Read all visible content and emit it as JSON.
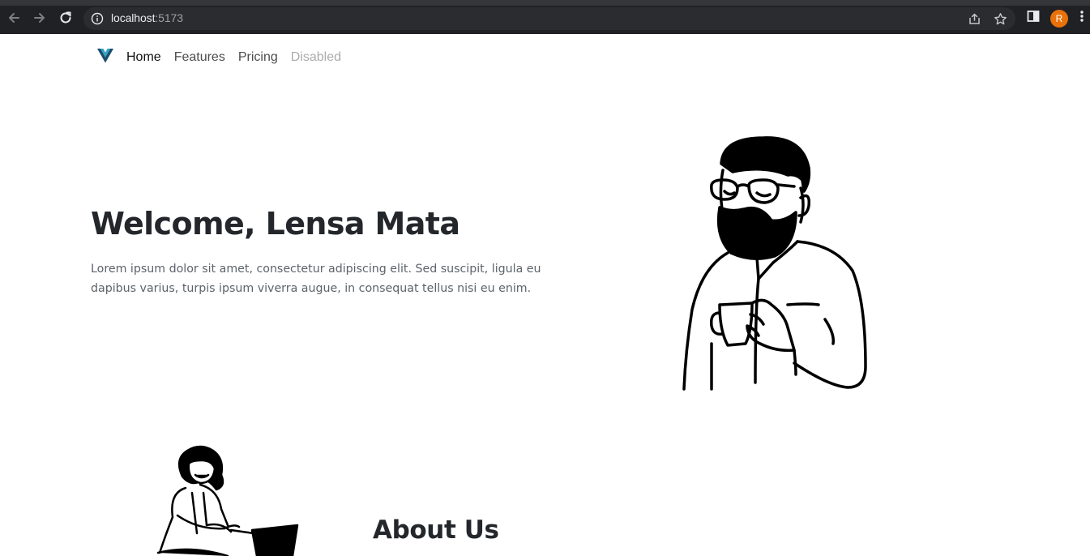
{
  "browser": {
    "url_host": "localhost",
    "url_port": ":5173",
    "profile_initial": "R",
    "icons": [
      "back-arrow-icon",
      "forward-arrow-icon",
      "reload-icon",
      "info-icon",
      "share-icon",
      "star-icon",
      "side-panel-icon",
      "kebab-menu-icon"
    ]
  },
  "navbar": {
    "logo": "vue-logo",
    "links": [
      {
        "label": "Home",
        "state": "active"
      },
      {
        "label": "Features",
        "state": "normal"
      },
      {
        "label": "Pricing",
        "state": "normal"
      },
      {
        "label": "Disabled",
        "state": "disabled"
      }
    ]
  },
  "hero": {
    "title": "Welcome, Lensa Mata",
    "text": "Lorem ipsum dolor sit amet, consectetur adipiscing elit. Sed suscipit, ligula eu dapibus varius, turpis ipsum viverra augue, in consequat tellus nisi eu enim."
  },
  "about": {
    "title": "About Us"
  },
  "colors": {
    "chrome_bg": "#202124",
    "omnibox_bg": "#2b2c30",
    "avatar": "#e8710a",
    "vue_dark": "#1a4d6e",
    "vue_light": "#2fa3c5",
    "heading": "#23262a",
    "body_text": "#5c636a",
    "disabled_link": "#a9abad"
  }
}
